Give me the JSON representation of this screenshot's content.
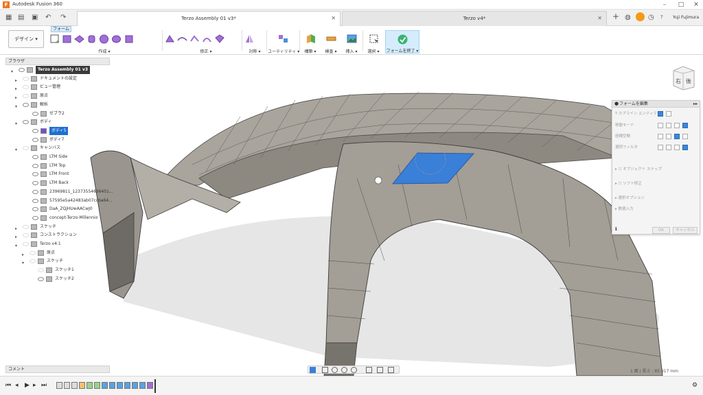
{
  "titlebar": {
    "app_title": "Autodesk Fusion 360",
    "app_icon": "F"
  },
  "tabs": [
    {
      "label": "Terzo Assembly 01 v3*"
    },
    {
      "label": "Terzo v4*"
    }
  ],
  "user": {
    "name": "Yuji Fujimura"
  },
  "ribbon": {
    "workspace": "デザイン ▾",
    "active_tab": "フォーム",
    "groups": [
      {
        "label": "作成 ▾"
      },
      {
        "label": "修正 ▾"
      },
      {
        "label": "対称 ▾"
      },
      {
        "label": "ユーティリティ ▾"
      },
      {
        "label": "構築 ▾"
      },
      {
        "label": "検査 ▾"
      },
      {
        "label": "挿入 ▾"
      },
      {
        "label": "選択 ▾"
      },
      {
        "label": "フォームを終了 ▾"
      }
    ]
  },
  "browser": {
    "header": "ブラウザ",
    "rows": [
      {
        "text": "Terzo Assembly 01 v3",
        "style": "root"
      },
      {
        "text": "ドキュメントの設定"
      },
      {
        "text": "ビュー管理"
      },
      {
        "text": "原点"
      },
      {
        "text": "解析"
      },
      {
        "text": "ゼブラ2"
      },
      {
        "text": "ボディ"
      },
      {
        "text": "ボディ5",
        "style": "sel"
      },
      {
        "text": "ボディ7"
      },
      {
        "text": "キャンバス"
      },
      {
        "text": "LTM Side"
      },
      {
        "text": "LTM Top"
      },
      {
        "text": "LTM Front"
      },
      {
        "text": "LTM Back"
      },
      {
        "text": "23969811_12373554636451..."
      },
      {
        "text": "57595e5a42483ab07ccba64..."
      },
      {
        "text": "DaA_ZQjHUwAACwJ0"
      },
      {
        "text": "concept-Terzo-Millennio"
      },
      {
        "text": "スケッチ"
      },
      {
        "text": "コンストラクション"
      },
      {
        "text": "Terzo v4:1"
      },
      {
        "text": "原点"
      },
      {
        "text": "スケッチ"
      },
      {
        "text": "スケッチ1"
      },
      {
        "text": "スケッチ2"
      }
    ]
  },
  "comment": {
    "label": "コメント"
  },
  "edit_panel": {
    "title": "フォームを編集",
    "rows": [
      {
        "label": "T-スプライン エンティティ"
      },
      {
        "label": "移動モード"
      },
      {
        "label": "座標空間"
      },
      {
        "label": "選択フィルタ"
      }
    ],
    "sections": [
      {
        "label": "オブジェクト スナップ"
      },
      {
        "label": "ソフト修正"
      },
      {
        "label": "選択オプション"
      },
      {
        "label": "数値入力"
      }
    ],
    "ok": "OK",
    "cancel": "キャンセル"
  },
  "viewcube": {
    "right": "右",
    "back": "後"
  },
  "status": {
    "readout": "1 面 | 長さ : 85.917 mm"
  },
  "colors": {
    "accent": "#1e6fd0",
    "selected_face": "#3a7fd8",
    "model": "#8e8b85",
    "finish_green": "#3cb371"
  }
}
